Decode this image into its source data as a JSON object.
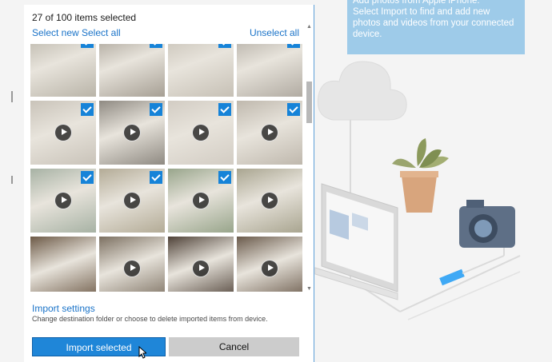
{
  "tip_text": "Select Import to find and add new photos and videos from your connected device.",
  "tip_cut_line": "Add photos from Apple iPhone.",
  "count_text": "27 of 100 items selected",
  "links": {
    "select_new": "Select new",
    "select_all": "Select all",
    "unselect_all": "Unselect all"
  },
  "import_settings": {
    "title": "Import settings",
    "desc": "Change destination folder or choose to delete imported items from device."
  },
  "buttons": {
    "import": "Import selected",
    "cancel": "Cancel"
  },
  "scroll_arrows": {
    "up": "▲",
    "down": "▼"
  },
  "thumbnails": [
    {
      "selected": true,
      "video": false,
      "tone": "#b9b4a8"
    },
    {
      "selected": true,
      "video": false,
      "tone": "#a69f94"
    },
    {
      "selected": true,
      "video": false,
      "tone": "#c6c0b5"
    },
    {
      "selected": true,
      "video": false,
      "tone": "#b1aba2"
    },
    {
      "selected": true,
      "video": true,
      "tone": "#c9c3b9"
    },
    {
      "selected": true,
      "video": true,
      "tone": "#8f8a82"
    },
    {
      "selected": true,
      "video": true,
      "tone": "#d2ccc3"
    },
    {
      "selected": true,
      "video": true,
      "tone": "#bfb8ad"
    },
    {
      "selected": true,
      "video": true,
      "tone": "#a7b2a4"
    },
    {
      "selected": true,
      "video": true,
      "tone": "#b3ab96"
    },
    {
      "selected": true,
      "video": true,
      "tone": "#98a58b"
    },
    {
      "selected": false,
      "video": true,
      "tone": "#a9a590"
    },
    {
      "selected": false,
      "video": false,
      "tone": "#6d5a47"
    },
    {
      "selected": false,
      "video": true,
      "tone": "#7c7061"
    },
    {
      "selected": false,
      "video": true,
      "tone": "#4f4238"
    },
    {
      "selected": false,
      "video": true,
      "tone": "#6a5a4b"
    },
    {
      "selected": false,
      "video": false,
      "tone": "#7d6b5a"
    },
    {
      "selected": false,
      "video": false,
      "tone": "#5f5148"
    },
    {
      "selected": false,
      "video": false,
      "tone": "#73655a"
    },
    {
      "selected": false,
      "video": false,
      "tone": "#6e6157"
    }
  ]
}
